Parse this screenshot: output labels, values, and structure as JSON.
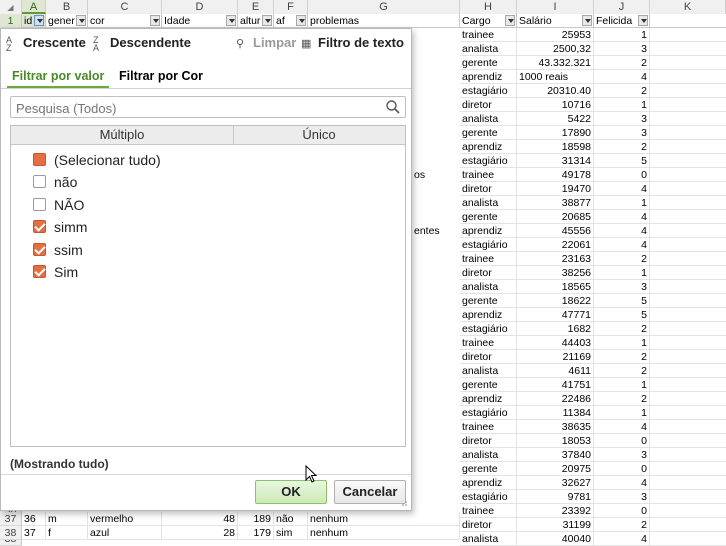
{
  "sheet": {
    "columns": [
      "A",
      "B",
      "C",
      "D",
      "E",
      "F",
      "G",
      "H",
      "I",
      "J",
      "K"
    ],
    "header": {
      "row": "1",
      "cells": [
        "id",
        "gener",
        "cor",
        "Idade",
        "altur",
        "af",
        "problemas",
        "Cargo",
        "Salário",
        "Felicida"
      ]
    },
    "partial_text": {
      "g_row11": "os",
      "g_row15": "entes"
    },
    "right_rows": [
      {
        "cargo": "trainee",
        "salario": "25953",
        "felic": "1"
      },
      {
        "cargo": "analista",
        "salario": "2500,32",
        "felic": "3"
      },
      {
        "cargo": "gerente",
        "salario": "43.332.321",
        "felic": "2"
      },
      {
        "cargo": "aprendiz",
        "salario": "1000 reais",
        "felic": "4"
      },
      {
        "cargo": "estagiário",
        "salario": "20310.40",
        "felic": "2"
      },
      {
        "cargo": "diretor",
        "salario": "10716",
        "felic": "1"
      },
      {
        "cargo": "analista",
        "salario": "5422",
        "felic": "3"
      },
      {
        "cargo": "gerente",
        "salario": "17890",
        "felic": "3"
      },
      {
        "cargo": "aprendiz",
        "salario": "18598",
        "felic": "2"
      },
      {
        "cargo": "estagiário",
        "salario": "31314",
        "felic": "5"
      },
      {
        "cargo": "trainee",
        "salario": "49178",
        "felic": "0"
      },
      {
        "cargo": "diretor",
        "salario": "19470",
        "felic": "4"
      },
      {
        "cargo": "analista",
        "salario": "38877",
        "felic": "1"
      },
      {
        "cargo": "gerente",
        "salario": "20685",
        "felic": "4"
      },
      {
        "cargo": "aprendiz",
        "salario": "45556",
        "felic": "4"
      },
      {
        "cargo": "estagiário",
        "salario": "22061",
        "felic": "4"
      },
      {
        "cargo": "trainee",
        "salario": "23163",
        "felic": "2"
      },
      {
        "cargo": "diretor",
        "salario": "38256",
        "felic": "1"
      },
      {
        "cargo": "analista",
        "salario": "18565",
        "felic": "3"
      },
      {
        "cargo": "gerente",
        "salario": "18622",
        "felic": "5"
      },
      {
        "cargo": "aprendiz",
        "salario": "47771",
        "felic": "5"
      },
      {
        "cargo": "estagiário",
        "salario": "1682",
        "felic": "2"
      },
      {
        "cargo": "trainee",
        "salario": "44403",
        "felic": "1"
      },
      {
        "cargo": "diretor",
        "salario": "21169",
        "felic": "2"
      },
      {
        "cargo": "analista",
        "salario": "4611",
        "felic": "2"
      },
      {
        "cargo": "gerente",
        "salario": "41751",
        "felic": "1"
      },
      {
        "cargo": "aprendiz",
        "salario": "22486",
        "felic": "2"
      },
      {
        "cargo": "estagiário",
        "salario": "11384",
        "felic": "1"
      },
      {
        "cargo": "trainee",
        "salario": "38635",
        "felic": "4"
      },
      {
        "cargo": "diretor",
        "salario": "18053",
        "felic": "0"
      },
      {
        "cargo": "analista",
        "salario": "37840",
        "felic": "3"
      },
      {
        "cargo": "gerente",
        "salario": "20975",
        "felic": "0"
      },
      {
        "cargo": "aprendiz",
        "salario": "32627",
        "felic": "4"
      },
      {
        "cargo": "estagiário",
        "salario": "9781",
        "felic": "3"
      },
      {
        "cargo": "trainee",
        "salario": "23392",
        "felic": "0"
      },
      {
        "cargo": "diretor",
        "salario": "31199",
        "felic": "2"
      },
      {
        "cargo": "analista",
        "salario": "40040",
        "felic": "4"
      }
    ],
    "bottom_rows": [
      {
        "row": "37",
        "id": "36",
        "gen": "m",
        "cor": "vermelho",
        "idade": "48",
        "alt": "189",
        "af": "não",
        "prob": "nenhum"
      },
      {
        "row": "38",
        "id": "37",
        "gen": "f",
        "cor": "azul",
        "idade": "28",
        "alt": "179",
        "af": "sim",
        "prob": "nenhum"
      }
    ]
  },
  "popup": {
    "sort_asc": "Crescente",
    "sort_desc": "Descendente",
    "clear": "Limpar",
    "text_filter": "Filtro de texto",
    "tab_value": "Filtrar por valor",
    "tab_color": "Filtrar por Cor",
    "search_placeholder": "Pesquisa (Todos)",
    "col_multiple": "Múltiplo",
    "col_single": "Único",
    "items": [
      {
        "label": "(Selecionar tudo)",
        "state": "indeterminate"
      },
      {
        "label": "não",
        "state": "unchecked"
      },
      {
        "label": "NÃO",
        "state": "unchecked"
      },
      {
        "label": "simm",
        "state": "checked"
      },
      {
        "label": "ssim",
        "state": "checked"
      },
      {
        "label": "Sim",
        "state": "checked"
      }
    ],
    "status": "(Mostrando tudo)",
    "ok_label": "OK",
    "cancel_label": "Cancelar",
    "accent_color": "#e46f43",
    "tab_active_color": "#4a8a2a"
  }
}
